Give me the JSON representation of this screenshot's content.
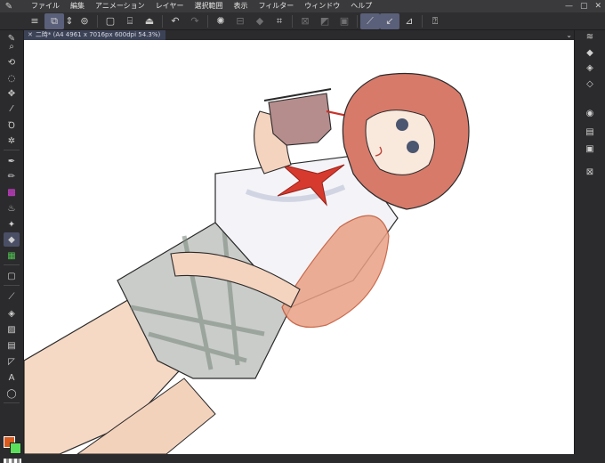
{
  "menubar": {
    "items": [
      "ファイル",
      "編集",
      "アニメーション",
      "レイヤー",
      "選択範囲",
      "表示",
      "フィルター",
      "ウィンドウ",
      "ヘルプ"
    ]
  },
  "tab": {
    "title": "二時* (A4 4961 x 7016px 600dpi 54.3%)"
  },
  "colors": {
    "main_color": "#d95a1e",
    "sub_color": "#5ce05c",
    "active_tool_bg": "#4a4f66"
  },
  "icons": {
    "toolbar": [
      "menu-icon",
      "layer-property-icon",
      "chevron-updown-icon",
      "quick-access-icon",
      "new-canvas-icon",
      "open-icon",
      "save-icon",
      "undo-icon",
      "redo-icon",
      "loading-icon",
      "clear-icon",
      "fill-icon",
      "transform-icon",
      "hide-selection-icon",
      "invert-icon",
      "select-color-icon",
      "stabilizer-icon",
      "snap-ruler-icon",
      "snap-special-ruler-icon",
      "help-icon"
    ],
    "tools": [
      "zoom-icon",
      "move-icon",
      "lasso-icon",
      "move-layer-icon",
      "eyedropper-icon",
      "lasso-select-icon",
      "magic-wand-icon",
      "pen-icon",
      "pencil-icon",
      "brush-icon",
      "airbrush-icon",
      "decoration-icon",
      "eraser-icon",
      "blend-icon",
      "frame-icon",
      "line-icon",
      "fill-bucket-icon",
      "gradient-icon",
      "figure-icon",
      "ruler-icon",
      "text-icon",
      "balloon-icon"
    ],
    "right_panel": [
      "layers-icon",
      "new-raster-layer-icon",
      "new-vector-layer-icon",
      "new-folder-icon",
      "layer-mask-icon",
      "merge-icon",
      "delete-layer-icon",
      "clear-layer-icon"
    ]
  }
}
